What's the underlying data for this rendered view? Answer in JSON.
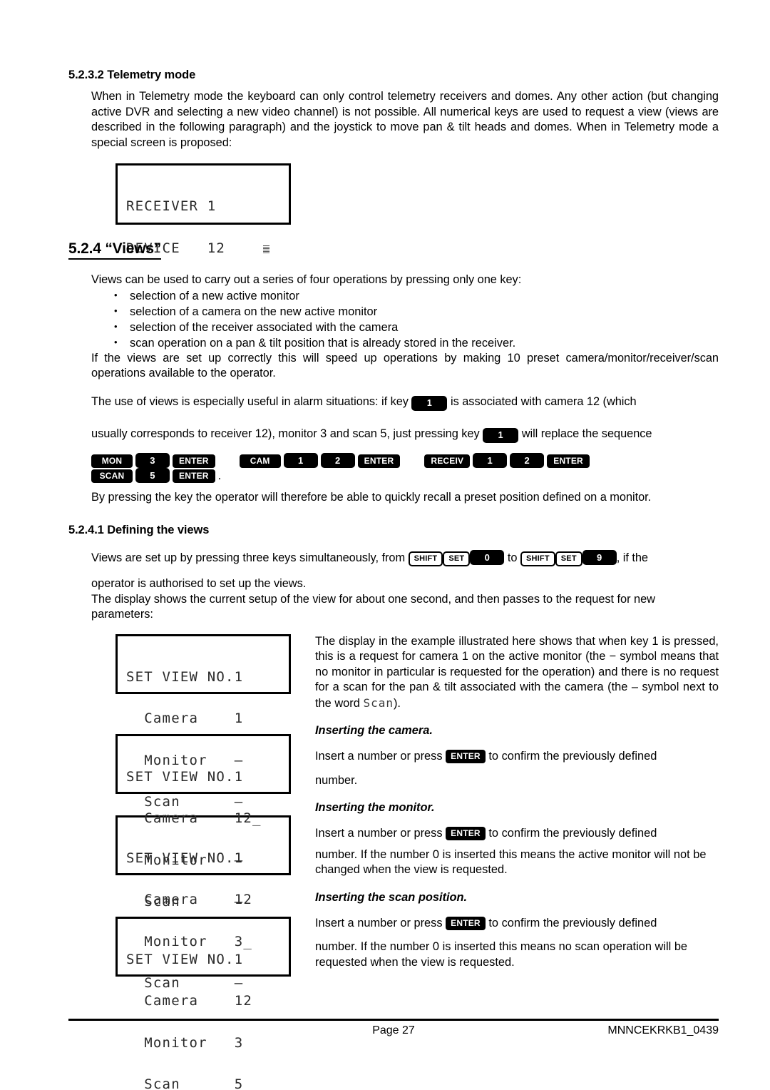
{
  "sections": {
    "telemetry": {
      "heading": "5.2.3.2 Telemetry mode",
      "paragraph": "When in Telemetry mode the keyboard can only control telemetry receivers and domes. Any other action (but changing active DVR and selecting a new video channel) is not possible. All numerical keys are used to request a view (views are described in the following paragraph) and the joystick to move pan & tilt heads and domes. When in Telemetry mode a special screen is proposed:"
    },
    "views": {
      "heading": "5.2.4 “Views”",
      "intro": "Views can be used to carry out a series of four operations by pressing only one key:",
      "bullets": [
        "selection of a new active monitor",
        "selection of a camera on the new active monitor",
        "selection of the receiver associated with the camera",
        "scan operation on a pan & tilt position that is already stored in the receiver."
      ],
      "after_bullets": "If the views are set up correctly this will speed up operations by making 10 preset camera/monitor/receiver/scan operations available to the operator.",
      "alarm_line_1a": "The use of views is especially useful in alarm situations: if key",
      "alarm_key_1": "1",
      "alarm_line_1b": "is associated with camera 12 (which",
      "alarm_line_2a": "usually corresponds to receiver 12), monitor 3 and scan 5, just pressing key",
      "alarm_key_2": "1",
      "alarm_line_2b": "will replace the sequence",
      "sequence_trailing": ".",
      "closing": "By pressing the key the operator will therefore be able to quickly recall a preset position defined on a monitor."
    },
    "defining": {
      "heading": "5.2.4.1 Defining the views",
      "line_a": "Views are set up by pressing three keys simultaneously, from",
      "line_mid": "to",
      "line_b": ", if the",
      "line_c": "operator is authorised to set up the views.",
      "line_d": "The display shows the current setup of the view for about one second, and then passes to the request for new parameters:"
    }
  },
  "key_sequence": [
    {
      "group": [
        "MON",
        "3",
        "ENTER"
      ]
    },
    {
      "group": [
        "CAM",
        "1",
        "2",
        "ENTER"
      ]
    },
    {
      "group": [
        "RECEIV",
        "1",
        "2",
        "ENTER"
      ]
    },
    {
      "group": [
        "SCAN",
        "5",
        "ENTER"
      ]
    }
  ],
  "shortcut_keys": {
    "from": [
      "SHIFT",
      "SET",
      "0"
    ],
    "to": [
      "SHIFT",
      "SET",
      "9"
    ]
  },
  "lcd_telemetry": {
    "line1": "RECEIVER 1",
    "line2_label": "DEVICE",
    "line2_value": "12"
  },
  "lcd_views": [
    {
      "title": "SET VIEW NO.1",
      "camera_label": "Camera",
      "camera_value": "1",
      "monitor_label": "Monitor",
      "monitor_value": "–",
      "scan_label": "Scan",
      "scan_value": "–"
    },
    {
      "title": "SET VIEW NO.1",
      "camera_label": "Camera",
      "camera_value": "12_",
      "monitor_label": "Monitor",
      "monitor_value": "–",
      "scan_label": "Scan",
      "scan_value": "–"
    },
    {
      "title": "SET VIEW NO.1",
      "camera_label": "Camera",
      "camera_value": "12",
      "monitor_label": "Monitor",
      "monitor_value": "3_",
      "scan_label": "Scan",
      "scan_value": "–"
    },
    {
      "title": "SET VIEW NO.1",
      "camera_label": "Camera",
      "camera_value": "12",
      "monitor_label": "Monitor",
      "monitor_value": "3",
      "scan_label": "Scan",
      "scan_value": "5_"
    }
  ],
  "right_column": {
    "example_text_a": "The display in the example illustrated here shows that when key 1 is pressed, this is a request for camera 1 on the active monitor (the − symbol means that no monitor in particular is requested for the operation) and there is no request for a scan for the pan & tilt associated with the camera (the",
    "example_symbol": "–",
    "example_text_b": "symbol next to the word",
    "example_lcd_word": "Scan",
    "example_text_c": ").",
    "camera_heading": "Inserting the camera.",
    "camera_text_a": "Insert a number or press",
    "camera_key": "ENTER",
    "camera_text_b": "to confirm the previously defined",
    "camera_text_c": "number.",
    "monitor_heading": "Inserting the monitor.",
    "monitor_text_a": "Insert a number or press",
    "monitor_key": "ENTER",
    "monitor_text_b": "to confirm the previously defined",
    "monitor_text_c": "number. If the number 0 is inserted this means the active monitor will not be changed when the view is requested.",
    "scan_heading": "Inserting the scan position.",
    "scan_text_a": "Insert a number or press",
    "scan_key": "ENTER",
    "scan_text_b": "to confirm the previously defined",
    "scan_text_c": "number. If the number 0 is inserted this means no scan operation will be requested when the view is requested."
  },
  "footer": {
    "page_label": "Page 27",
    "doc_code": "MNNCEKRKB1_0439"
  }
}
